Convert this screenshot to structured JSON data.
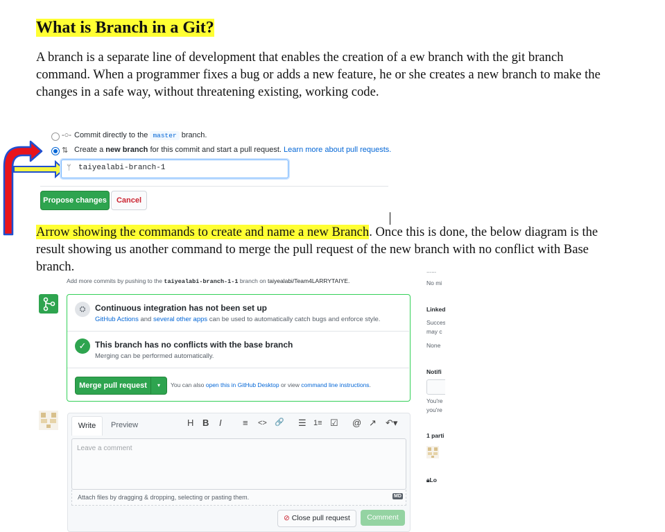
{
  "doc": {
    "heading": "What is Branch in a Git?",
    "intro_line1": "A branch is a separate line of development that enables the creation of a ew branch with the git branch",
    "intro_line2": "command. When a programmer fixes a bug or adds a new feature, he or she creates a new branch to make the",
    "intro_line3": "changes in a safe way, without threatening existing, working code.",
    "caption_highlight": "Arrow showing the commands to create and name a new Branch",
    "caption_rest": ". Once this is done, the below diagram is the",
    "caption_line2": "result showing us another command to merge the pull request of the new branch with no conflict with Base",
    "caption_line3": "branch."
  },
  "commit_form": {
    "option1_prefix": "Commit directly to the",
    "option1_branch": "master",
    "option1_suffix": "branch.",
    "option2_prefix": "Create a",
    "option2_bold": "new branch",
    "option2_middle": "for this commit and start a pull request.",
    "option2_link": "Learn more about pull requests.",
    "branch_name_value": "taiyealabi-branch-1",
    "propose_label": "Propose changes",
    "cancel_label": "Cancel"
  },
  "pr": {
    "add_commits_prefix": "Add more commits by pushing to the",
    "add_commits_branch": "taiyealabi-branch-1-1",
    "add_commits_middle": "branch on",
    "add_commits_repo": "taiyealabi/Team4LARRYTAIYE.",
    "ci_title": "Continuous integration has not been set up",
    "ci_link1": "GitHub Actions",
    "ci_and": "and",
    "ci_link2": "several other apps",
    "ci_desc": "can be used to automatically catch bugs and enforce style.",
    "conflict_title": "This branch has no conflicts with the base branch",
    "conflict_desc": "Merging can be performed automatically.",
    "merge_label": "Merge pull request",
    "merge_also": "You can also",
    "merge_link1": "open this in GitHub Desktop",
    "merge_or": "or view",
    "merge_link2": "command line instructions",
    "merge_end": "."
  },
  "comment": {
    "tab_write": "Write",
    "tab_preview": "Preview",
    "placeholder": "Leave a comment",
    "attach_text": "Attach files by dragging & dropping, selecting or pasting them.",
    "md_badge": "MD",
    "close_label": "Close pull request",
    "comment_label": "Comment",
    "toolbar_icons": [
      "heading-icon",
      "bold-icon",
      "italic-icon",
      "quote-icon",
      "code-icon",
      "link-icon",
      "bullet-list-icon",
      "numbered-list-icon",
      "task-list-icon",
      "mention-icon",
      "reference-icon",
      "reply-icon"
    ],
    "toolbar_glyphs": [
      "H",
      "B",
      "I",
      "≡",
      "<>",
      "🔗",
      "☰",
      "1≡",
      "☑",
      "@",
      "↗",
      "↶▾"
    ]
  },
  "sidebar": {
    "dots": "......",
    "no_milestone": "No mi",
    "linked": "Linked",
    "succes": "Succes",
    "may_c": "may c",
    "none": "None",
    "notifi": "Notifi",
    "youre1": "You're",
    "youre2": "you're",
    "participants": "1 parti",
    "lock": "Lo"
  },
  "colors": {
    "highlight": "#ffff33",
    "green": "#2ea44f",
    "link": "#0366d6",
    "arrow_red": "#e8141c",
    "arrow_blue": "#1f4fd0",
    "arrow_yellow": "#f5f542"
  }
}
